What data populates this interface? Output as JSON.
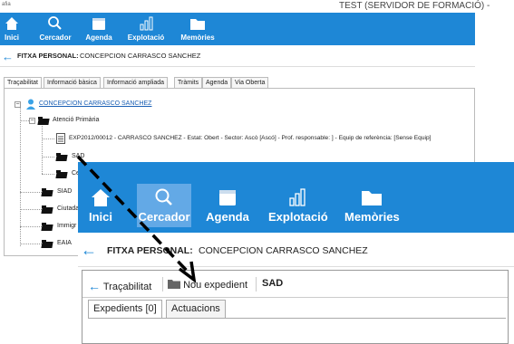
{
  "background": {
    "window_tag": "afia",
    "window_title": "TEST (SERVIDOR DE FORMACIÓ) -",
    "ribbon": [
      "Inici",
      "Cercador",
      "Agenda",
      "Explotació",
      "Memòries"
    ],
    "header": {
      "label": "FITXA PERSONAL:",
      "name": "CONCEPCION CARRASCO SANCHEZ"
    },
    "tabs": [
      "Traçabilitat",
      "Informació bàsica",
      "Informació ampliada",
      "Tràmits",
      "Agenda",
      "Via Oberta"
    ],
    "tree": {
      "person": "CONCEPCION CARRASCO SANCHEZ",
      "atencio": "Atenció Primària",
      "expedient": "EXP2012/00012 - CARRASCO SANCHEZ - Estat: Obert - Sector: Ascò [Ascó] - Prof. responsable: ] - Equip de referència: [Sense Equip]",
      "sad": "SAD",
      "centre": "Centre",
      "siad": "SIAD",
      "ciutada": "Ciutada",
      "immigr": "Immigr",
      "eaia": "EAIA"
    }
  },
  "foreground": {
    "ribbon": [
      "Inici",
      "Cercador",
      "Agenda",
      "Explotació",
      "Memòries"
    ],
    "header": {
      "label": "FITXA PERSONAL:",
      "name": "CONCEPCION CARRASCO SANCHEZ"
    },
    "toolbar": {
      "tracabilitat": "Traçabilitat",
      "nou_expedient": "Nou expedient",
      "context": "SAD"
    },
    "tabs": [
      "Expedients [0]",
      "Actuacions"
    ]
  },
  "colors": {
    "ribbon": "#1e87d6",
    "ribbon_selected": "#63a9e6",
    "accent": "#1e87d6"
  }
}
